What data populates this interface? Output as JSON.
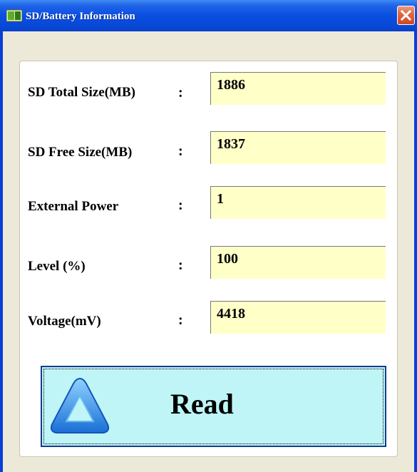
{
  "window": {
    "title": "SD/Battery Information",
    "icons": {
      "app": "battery-app-icon",
      "close": "close-icon",
      "read": "up-triangle-icon"
    }
  },
  "fields": [
    {
      "label": "SD Total Size(MB)",
      "value": "1886"
    },
    {
      "label": "SD Free Size(MB)",
      "value": "1837"
    },
    {
      "label": "External Power",
      "value": "1"
    },
    {
      "label": "Level (%)",
      "value": "100"
    },
    {
      "label": "Voltage(mV)",
      "value": "4418"
    }
  ],
  "colon": ":",
  "read_button": {
    "label": "Read"
  }
}
